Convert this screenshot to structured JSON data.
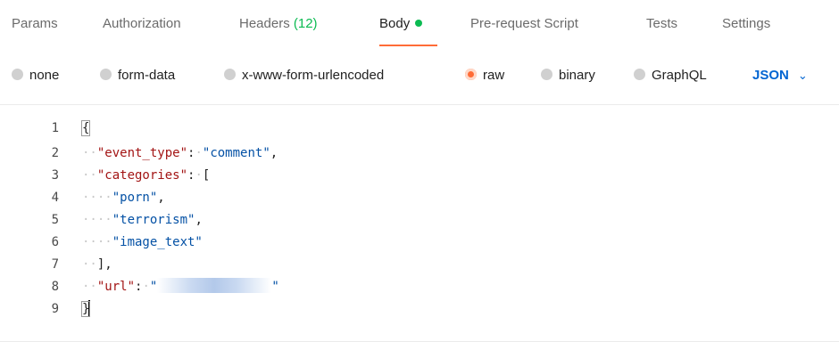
{
  "tabs": {
    "params": "Params",
    "authorization": "Authorization",
    "headers": "Headers",
    "headers_count": "(12)",
    "body": "Body",
    "prerequest": "Pre-request Script",
    "tests": "Tests",
    "settings": "Settings"
  },
  "body_modes": {
    "none": "none",
    "form_data": "form-data",
    "urlencoded": "x-www-form-urlencoded",
    "raw": "raw",
    "binary": "binary",
    "graphql": "GraphQL",
    "selected": "raw",
    "format": "JSON"
  },
  "editor": {
    "line_numbers": [
      "1",
      "2",
      "3",
      "4",
      "5",
      "6",
      "7",
      "8",
      "9"
    ],
    "open_brace": "{",
    "close_brace": "}",
    "key_event_type": "\"event_type\"",
    "val_event_type": "\"comment\"",
    "key_categories": "\"categories\"",
    "cat_1": "\"porn\"",
    "cat_2": "\"terrorism\"",
    "cat_3": "\"image_text\"",
    "key_url": "\"url\"",
    "url_open_quote": "\"",
    "url_close_quote": "\""
  },
  "colors": {
    "accent": "#ff6c37",
    "green": "#0cbb52",
    "json_blue": "#0265d2"
  }
}
